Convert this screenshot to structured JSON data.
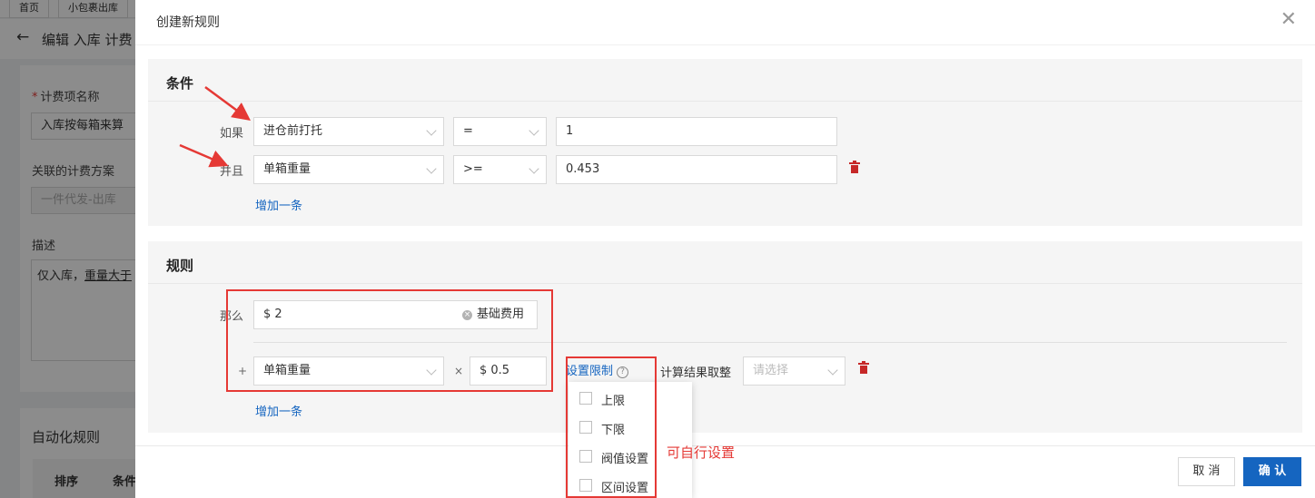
{
  "background": {
    "tabs": [
      "首页",
      "小包裹出库"
    ],
    "page_title": "编辑 入库 计费",
    "fields": {
      "name_label": "计费项名称",
      "name_value": "入库按每箱来算",
      "plan_label": "关联的计费方案",
      "plan_placeholder": "一件代发-出库",
      "desc_label": "描述",
      "desc_value_part1": "仅入库，",
      "desc_value_part2": "重量大于"
    },
    "automation_title": "自动化规则",
    "table_headers": [
      "排序",
      "条件"
    ]
  },
  "modal": {
    "title": "创建新规则",
    "close_icon": "close-icon",
    "conditions": {
      "title": "条件",
      "rows": [
        {
          "label": "如果",
          "field": "进仓前打托",
          "operator": "=",
          "value": "1"
        },
        {
          "label": "并且",
          "field": "单箱重量",
          "operator": ">=",
          "value": "0.453"
        }
      ],
      "add_link": "增加一条"
    },
    "rules": {
      "title": "规则",
      "then_label": "那么",
      "base_value": "$ 2",
      "base_tag": "基础费用",
      "plus": "+",
      "item_field": "单箱重量",
      "multiply": "×",
      "item_value": "$ 0.5",
      "limit_link": "设置限制",
      "rounding_label": "计算结果取整",
      "rounding_placeholder": "请选择",
      "add_link": "增加一条"
    },
    "limit_options": [
      "上限",
      "下限",
      "阀值设置",
      "区间设置"
    ],
    "footer": {
      "cancel": "取 消",
      "confirm": "确 认"
    }
  },
  "annotation_note": "可自行设置",
  "colors": {
    "primary": "#1565c0",
    "danger": "#c62828",
    "annotation": "#e53935"
  }
}
